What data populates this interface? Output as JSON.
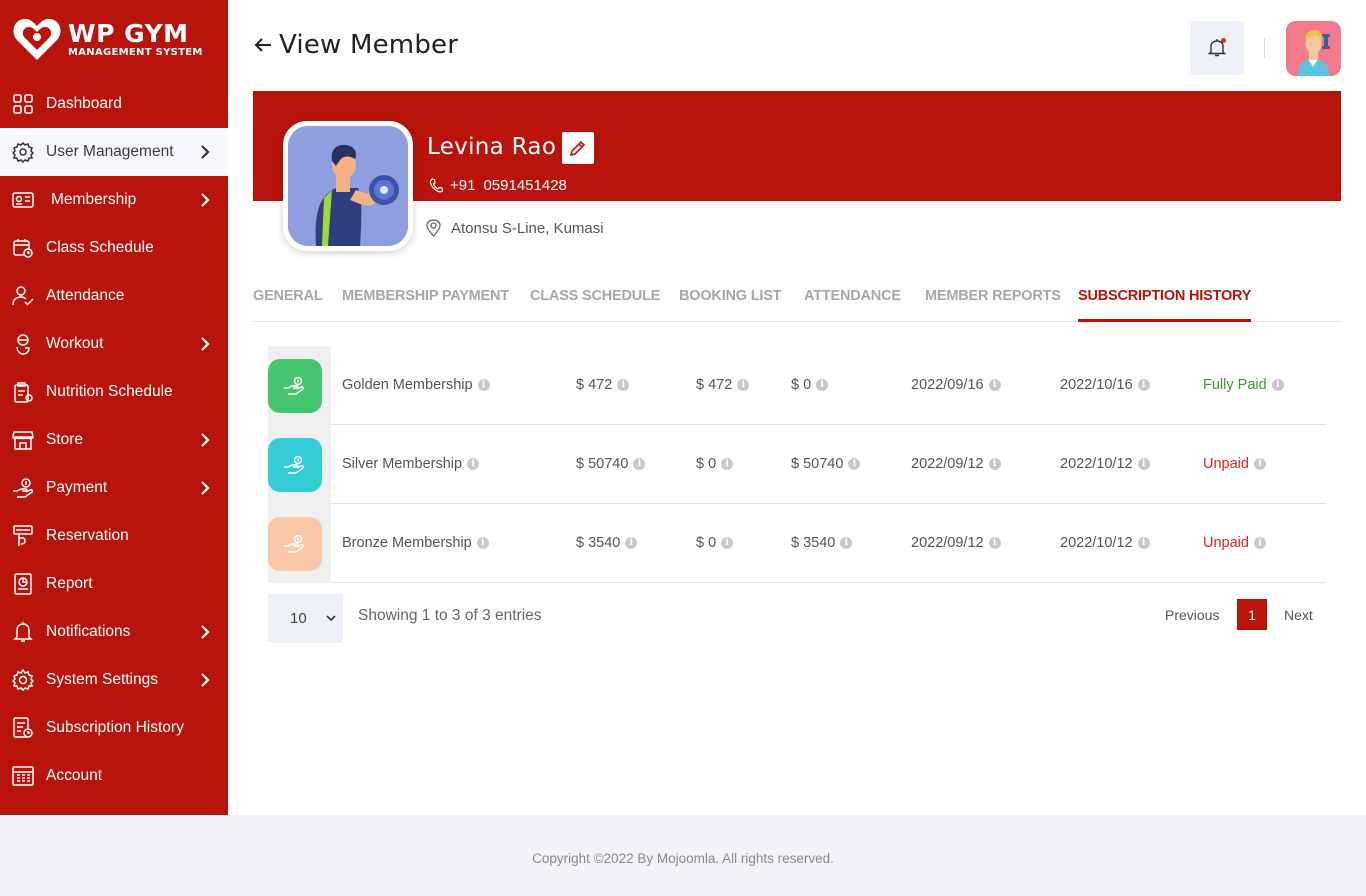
{
  "app": {
    "logo_title": "WP GYM",
    "logo_subtitle": "MANAGEMENT SYSTEM",
    "brand_color": "#b8140c"
  },
  "sidebar": {
    "items": [
      {
        "label": "Dashboard",
        "icon": "dashboard-grid-icon",
        "has_submenu": false,
        "active": false
      },
      {
        "label": "User Management",
        "icon": "users-gear-icon",
        "has_submenu": true,
        "active": true
      },
      {
        "label": "Membership",
        "icon": "membership-card-icon",
        "has_submenu": true,
        "active": false
      },
      {
        "label": "Class Schedule",
        "icon": "calendar-icon",
        "has_submenu": false,
        "active": false
      },
      {
        "label": "Attendance",
        "icon": "user-check-icon",
        "has_submenu": false,
        "active": false
      },
      {
        "label": "Workout",
        "icon": "workout-icon",
        "has_submenu": true,
        "active": false
      },
      {
        "label": "Nutrition Schedule",
        "icon": "nutrition-icon",
        "has_submenu": false,
        "active": false
      },
      {
        "label": "Store",
        "icon": "store-icon",
        "has_submenu": true,
        "active": false
      },
      {
        "label": "Payment",
        "icon": "payment-hand-icon",
        "has_submenu": true,
        "active": false
      },
      {
        "label": "Reservation",
        "icon": "reservation-icon",
        "has_submenu": false,
        "active": false
      },
      {
        "label": "Report",
        "icon": "report-icon",
        "has_submenu": false,
        "active": false
      },
      {
        "label": "Notifications",
        "icon": "bell-icon",
        "has_submenu": true,
        "active": false
      },
      {
        "label": "System Settings",
        "icon": "gear-icon",
        "has_submenu": true,
        "active": false
      },
      {
        "label": "Subscription History",
        "icon": "subscription-history-icon",
        "has_submenu": false,
        "active": false
      },
      {
        "label": "Account",
        "icon": "account-icon",
        "has_submenu": false,
        "active": false
      }
    ]
  },
  "header": {
    "title": "View Member"
  },
  "member": {
    "name": "Levina Rao",
    "phone_code": "+91",
    "phone": "0591451428",
    "address": "Atonsu S-Line, Kumasi"
  },
  "tabs": [
    {
      "label": "GENERAL",
      "active": false
    },
    {
      "label": "MEMBERSHIP PAYMENT",
      "active": false
    },
    {
      "label": "CLASS SCHEDULE",
      "active": false
    },
    {
      "label": "BOOKING LIST",
      "active": false
    },
    {
      "label": "ATTENDANCE",
      "active": false
    },
    {
      "label": "MEMBER REPORTS",
      "active": false
    },
    {
      "label": "SUBSCRIPTION HISTORY",
      "active": true
    }
  ],
  "subscriptions": [
    {
      "membership": "Golden Membership",
      "amount": "$ 472",
      "paid": "$ 472",
      "due": "$ 0",
      "start": "2022/09/16",
      "end": "2022/10/16",
      "status": "Fully Paid",
      "status_type": "paid",
      "icon_color": "#45c66e"
    },
    {
      "membership": "Silver Membership",
      "amount": "$ 50740",
      "paid": "$ 0",
      "due": "$ 50740",
      "start": "2022/09/12",
      "end": "2022/10/12",
      "status": "Unpaid",
      "status_type": "unpaid",
      "icon_color": "#34cdd6"
    },
    {
      "membership": "Bronze Membership",
      "amount": "$ 3540",
      "paid": "$ 0",
      "due": "$ 3540",
      "start": "2022/09/12",
      "end": "2022/10/12",
      "status": "Unpaid",
      "status_type": "unpaid",
      "icon_color": "#fbc7a9"
    }
  ],
  "pagination": {
    "page_size": "10",
    "info": "Showing 1 to 3 of 3 entries",
    "previous": "Previous",
    "current_page": "1",
    "next": "Next"
  },
  "footer": {
    "copyright": "Copyright ©2022 By Mojoomla. All rights reserved."
  }
}
